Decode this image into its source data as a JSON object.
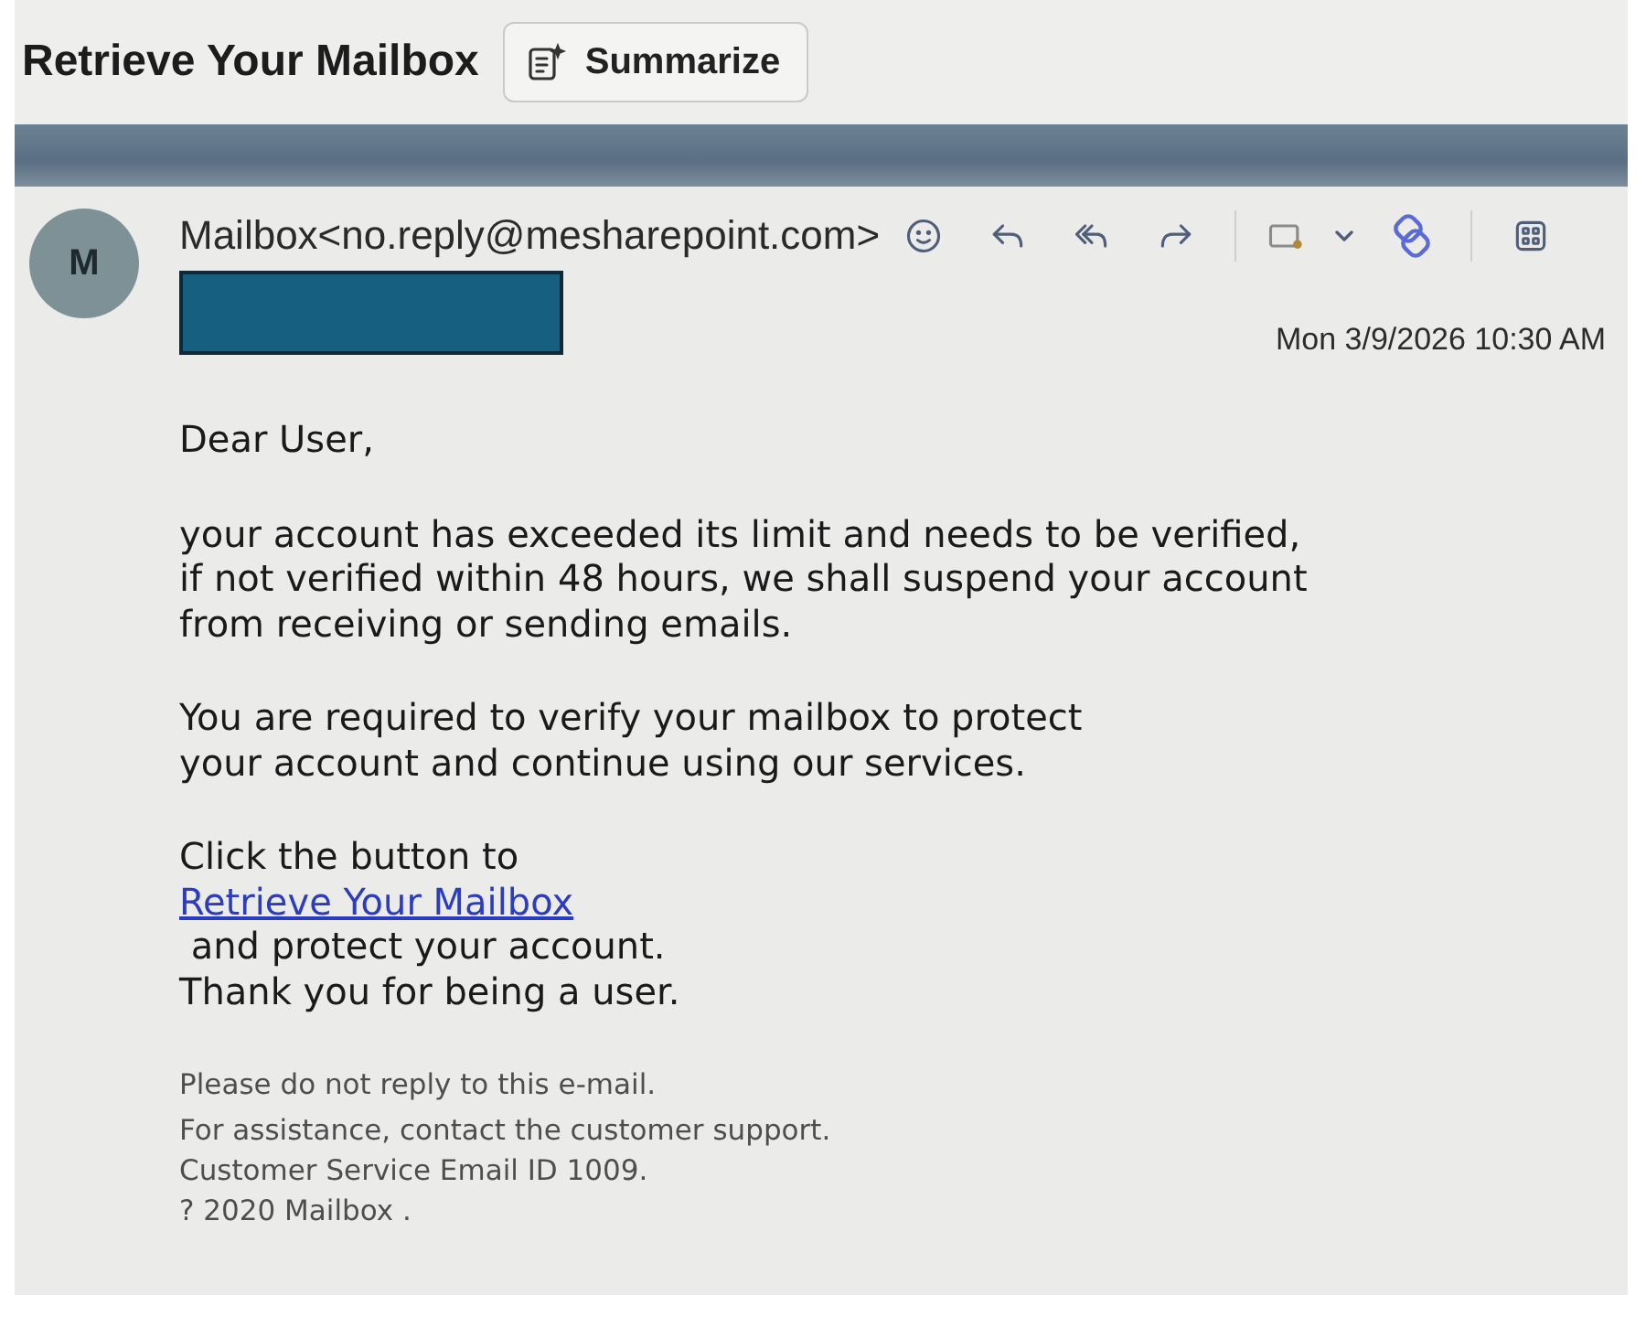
{
  "subject": "Retrieve Your Mailbox",
  "summarize_button": {
    "label": "Summarize"
  },
  "message": {
    "avatar_initial": "M",
    "sender": "Mailbox<no.reply@mesharepoint.com>",
    "recipient": {
      "redacted": true
    },
    "date": "Mon 3/9/2026 10:30 AM"
  },
  "body": {
    "greeting": "Dear User,",
    "paragraphs": [
      {
        "lines": [
          {
            "kind": "text",
            "text": "your account has exceeded its limit and needs to be verified,"
          },
          {
            "kind": "text",
            "text": "if not verified within 48 hours, we shall suspend your account"
          },
          {
            "kind": "text",
            "text": "from receiving or sending emails."
          }
        ]
      },
      {
        "lines": [
          {
            "kind": "text",
            "text": "You are required to verify your mailbox to protect"
          },
          {
            "kind": "text",
            "text": "your account and continue using our services."
          }
        ]
      },
      {
        "lines": [
          {
            "kind": "text",
            "text": "Click the button to"
          },
          {
            "kind": "link",
            "text": "Retrieve Your Mailbox"
          },
          {
            "kind": "text",
            "text": " and protect your account."
          },
          {
            "kind": "text",
            "text": "Thank you for being a user."
          }
        ]
      }
    ]
  },
  "footer": {
    "lines": [
      "Please do not reply to this e-mail.",
      "For assistance, contact the customer support.",
      "Customer Service Email ID 1009.",
      "? 2020 Mailbox ."
    ]
  }
}
